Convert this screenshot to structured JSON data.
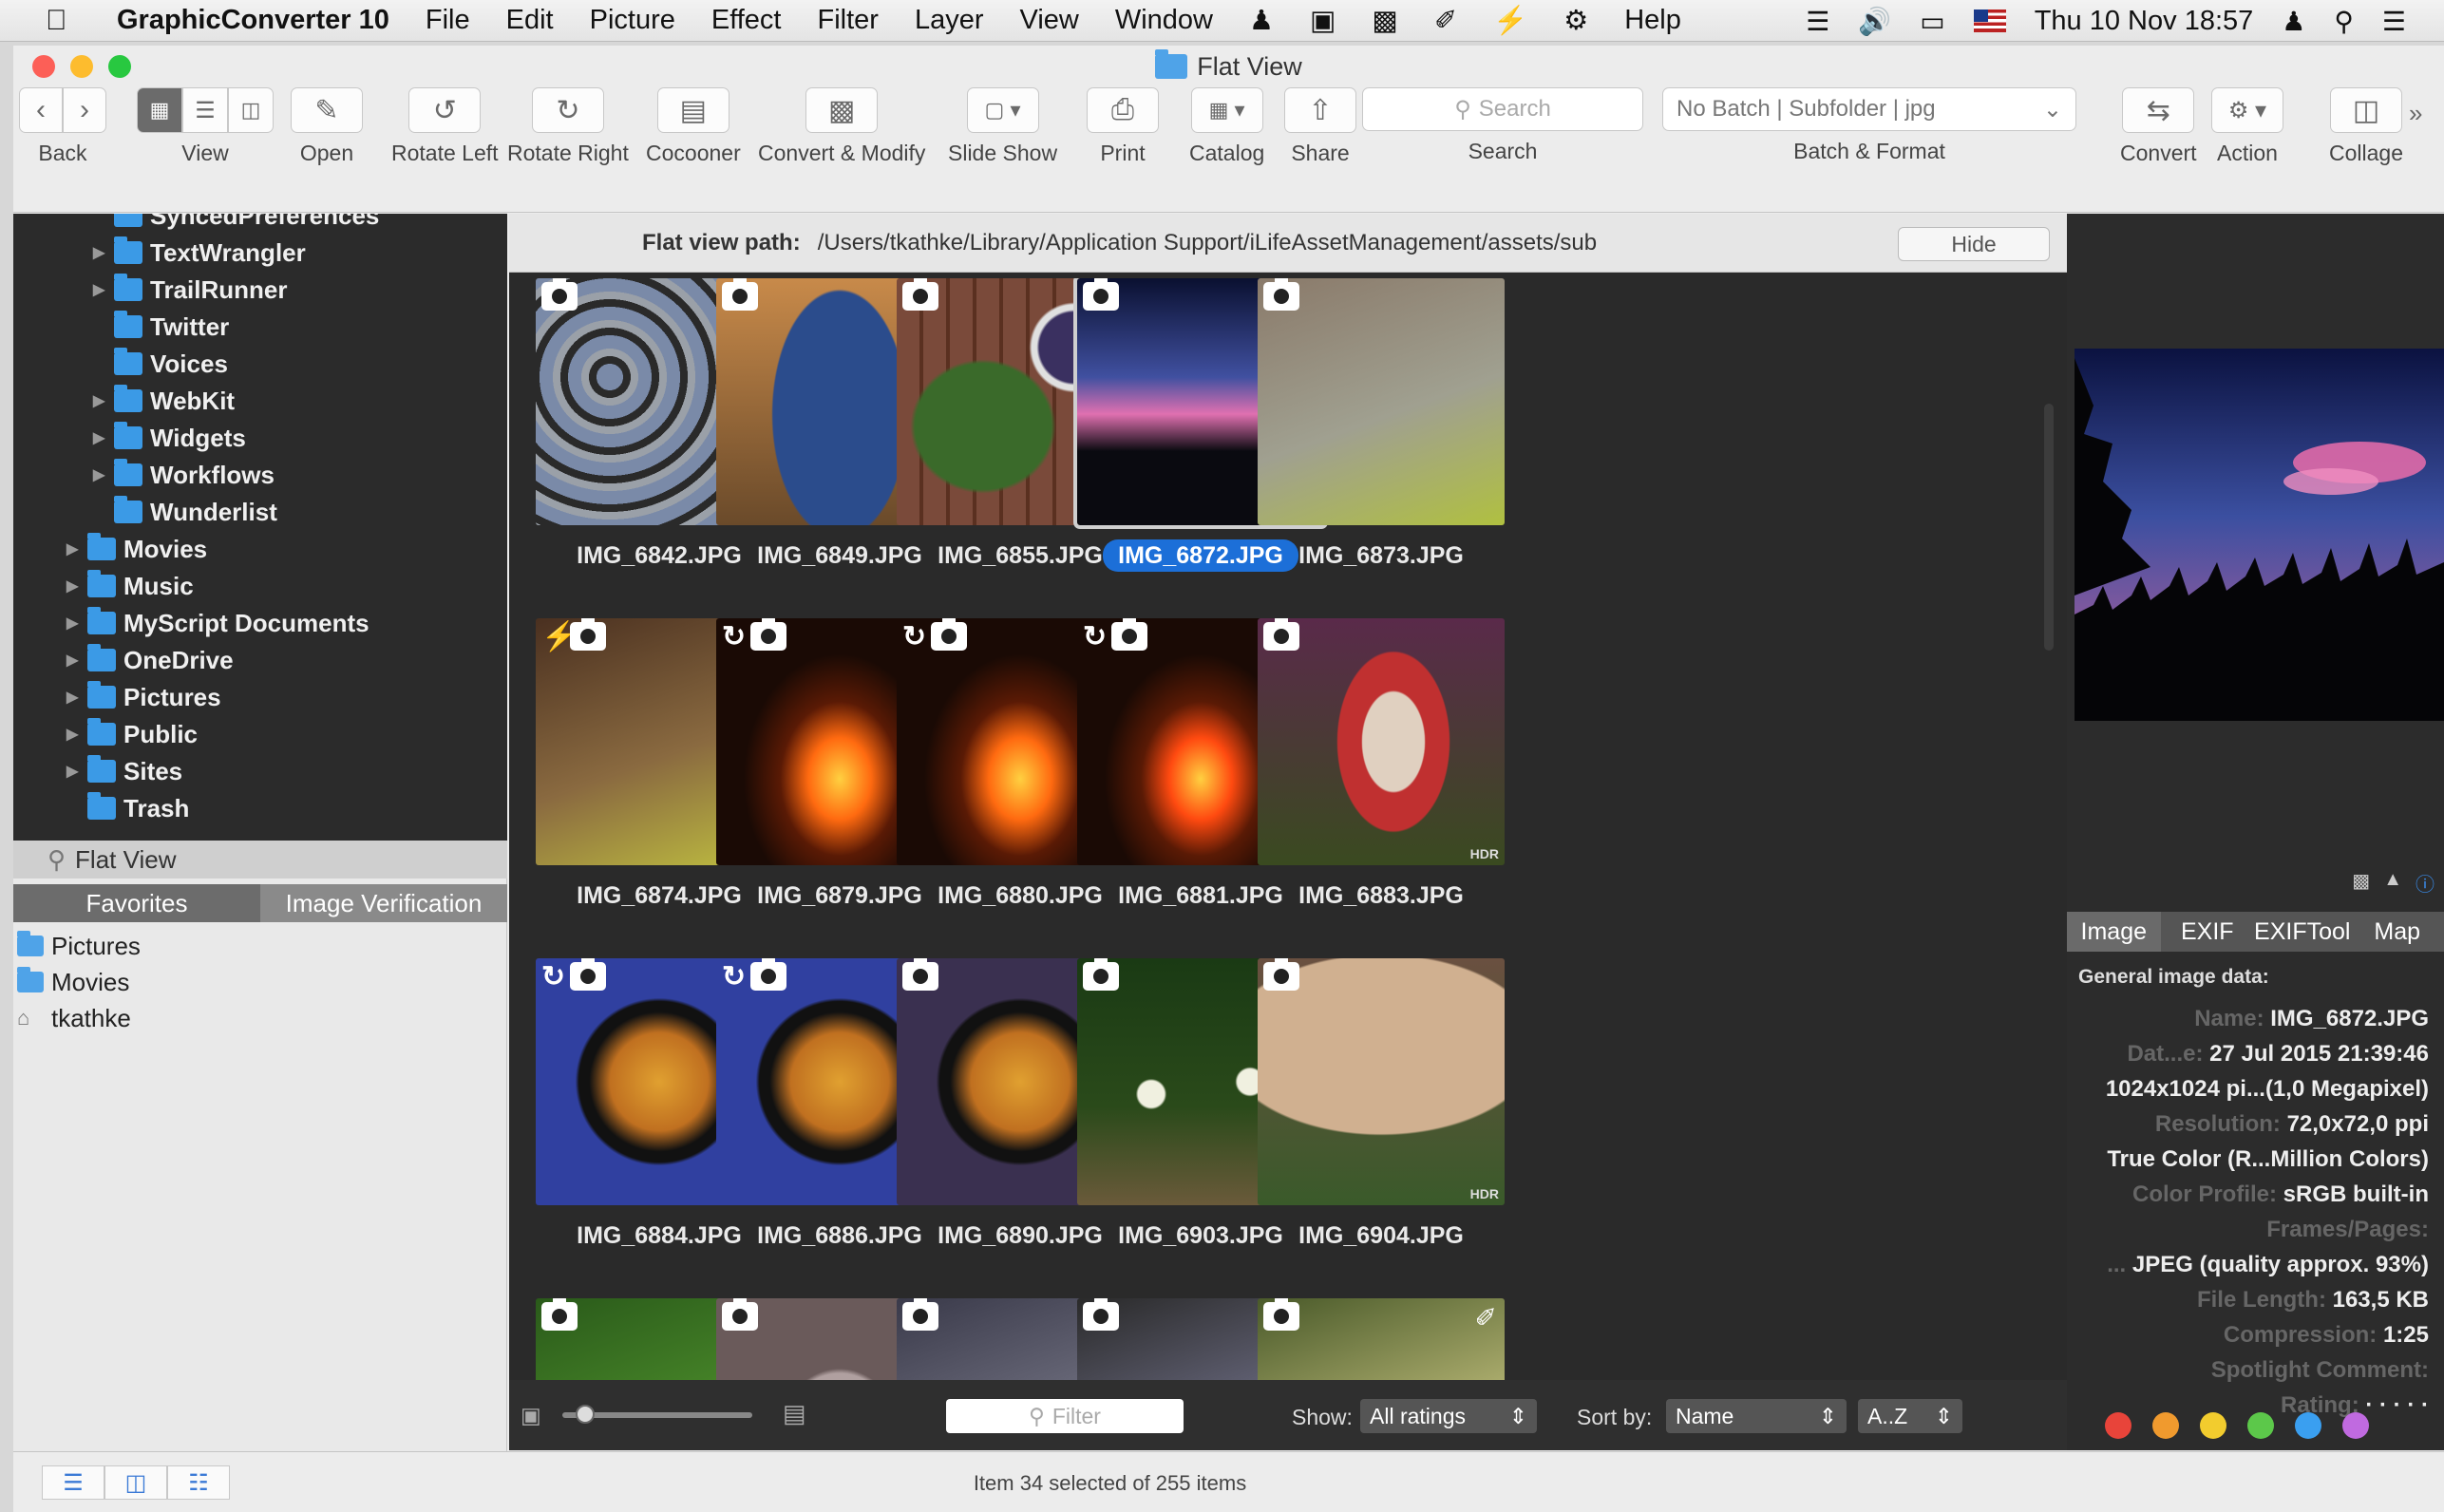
{
  "menubar": {
    "app_name": "GraphicConverter 10",
    "items": [
      "File",
      "Edit",
      "Picture",
      "Effect",
      "Filter",
      "Layer",
      "View",
      "Window"
    ],
    "help": "Help",
    "clock": "Thu 10 Nov  18:57"
  },
  "window": {
    "title": "Flat View"
  },
  "toolbar": {
    "back": "Back",
    "view": "View",
    "open": "Open",
    "rotate_left": "Rotate Left",
    "rotate_right": "Rotate Right",
    "cocooner": "Cocooner",
    "convert_modify": "Convert & Modify",
    "slide_show": "Slide Show",
    "print": "Print",
    "catalog": "Catalog",
    "share": "Share",
    "search_placeholder": "Search",
    "search_label": "Search",
    "batch_value": "No Batch | Subfolder | jpg",
    "batch_label": "Batch & Format",
    "convert": "Convert",
    "action": "Action",
    "collage": "Collage"
  },
  "sidebar": {
    "tree": [
      {
        "label": "SyncedPreferences",
        "level": 2,
        "arrow": false
      },
      {
        "label": "TextWrangler",
        "level": 2,
        "arrow": true
      },
      {
        "label": "TrailRunner",
        "level": 2,
        "arrow": true
      },
      {
        "label": "Twitter",
        "level": 2,
        "arrow": false
      },
      {
        "label": "Voices",
        "level": 2,
        "arrow": false
      },
      {
        "label": "WebKit",
        "level": 2,
        "arrow": true
      },
      {
        "label": "Widgets",
        "level": 2,
        "arrow": true
      },
      {
        "label": "Workflows",
        "level": 2,
        "arrow": true
      },
      {
        "label": "Wunderlist",
        "level": 2,
        "arrow": false
      },
      {
        "label": "Movies",
        "level": 1,
        "arrow": true
      },
      {
        "label": "Music",
        "level": 1,
        "arrow": true
      },
      {
        "label": "MyScript Documents",
        "level": 1,
        "arrow": true
      },
      {
        "label": "OneDrive",
        "level": 1,
        "arrow": true
      },
      {
        "label": "Pictures",
        "level": 1,
        "arrow": true
      },
      {
        "label": "Public",
        "level": 1,
        "arrow": true
      },
      {
        "label": "Sites",
        "level": 1,
        "arrow": true
      },
      {
        "label": "Trash",
        "level": 1,
        "arrow": false
      }
    ],
    "flat_view": "Flat View",
    "tabs": [
      "Favorites",
      "Image Verification"
    ],
    "favorites": [
      "Pictures",
      "Movies",
      "tkathke"
    ]
  },
  "pathbar": {
    "label": "Flat view path:",
    "path": "/Users/tkathke/Library/Application Support/iLifeAssetManagement/assets/sub",
    "hide": "Hide"
  },
  "thumbnails": [
    {
      "name": "IMG_6842.JPG"
    },
    {
      "name": "IMG_6849.JPG"
    },
    {
      "name": "IMG_6855.JPG"
    },
    {
      "name": "IMG_6872.JPG",
      "selected": true
    },
    {
      "name": "IMG_6873.JPG"
    },
    {
      "name": "IMG_6874.JPG"
    },
    {
      "name": "IMG_6879.JPG"
    },
    {
      "name": "IMG_6880.JPG"
    },
    {
      "name": "IMG_6881.JPG"
    },
    {
      "name": "IMG_6883.JPG"
    },
    {
      "name": "IMG_6884.JPG"
    },
    {
      "name": "IMG_6886.JPG"
    },
    {
      "name": "IMG_6890.JPG"
    },
    {
      "name": "IMG_6903.JPG"
    },
    {
      "name": "IMG_6904.JPG"
    },
    {
      "name": ""
    },
    {
      "name": ""
    },
    {
      "name": ""
    },
    {
      "name": ""
    },
    {
      "name": ""
    }
  ],
  "hdr_badge": "HDR",
  "bottombar": {
    "filter_placeholder": "Filter",
    "show_label": "Show:",
    "show_value": "All ratings",
    "sort_label": "Sort by:",
    "sort_value": "Name",
    "order_value": "A..Z"
  },
  "inspector": {
    "tabs": [
      "Image",
      "EXIF",
      "EXIFTool",
      "Map"
    ],
    "section": "General image data:",
    "rows": [
      {
        "k": "Name:",
        "v": "IMG_6872.JPG"
      },
      {
        "k": "Dat...e:",
        "v": "27 Jul 2015 21:39:46"
      },
      {
        "k": "",
        "v": "1024x1024 pi...(1,0 Megapixel)"
      },
      {
        "k": "Resolution:",
        "v": "72,0x72,0 ppi"
      },
      {
        "k": "",
        "v": "True Color (R...Million Colors)"
      },
      {
        "k": "Color Profile:",
        "v": "sRGB built-in"
      },
      {
        "k": "Frames/Pages:",
        "v": ""
      },
      {
        "k": "...",
        "v": "JPEG (quality approx. 93%)"
      },
      {
        "k": "File Length:",
        "v": "163,5 KB"
      },
      {
        "k": "Compression:",
        "v": "1:25"
      },
      {
        "k": "Spotlight Comment:",
        "v": ""
      },
      {
        "k": "Rating:",
        "v": "·  ·  ·  ·  ·"
      }
    ],
    "label_colors": [
      "#e8443a",
      "#f09a2e",
      "#f2cc2e",
      "#5cc84a",
      "#3a9ff0",
      "#c06ae0"
    ]
  },
  "statusbar": {
    "text": "Item 34 selected of 255 items"
  }
}
